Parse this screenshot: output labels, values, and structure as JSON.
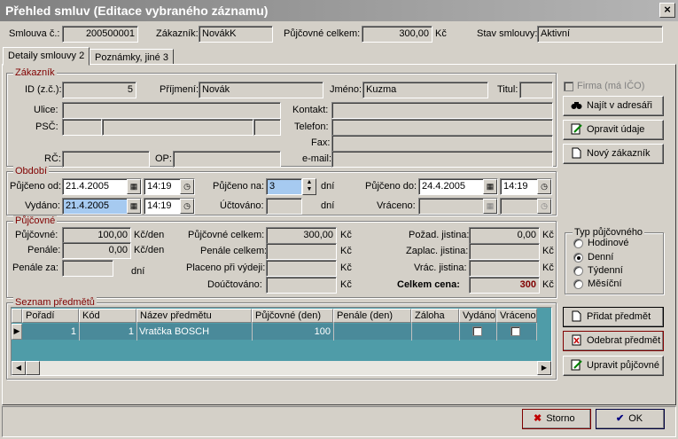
{
  "window": {
    "title": "Přehled smluv (Editace vybraného záznamu)"
  },
  "header": {
    "contract_label": "Smlouva č.:",
    "contract_value": "200500001",
    "customer_label": "Zákazník:",
    "customer_value": "NovákK",
    "rental_total_label": "Půjčovné celkem:",
    "rental_total_value": "300,00",
    "rental_total_currency": "Kč",
    "state_label": "Stav smlouvy:",
    "state_value": "Aktivní"
  },
  "tabs": [
    {
      "label": "Detaily smlouvy 2"
    },
    {
      "label": "Poznámky, jiné 3"
    }
  ],
  "customer": {
    "title": "Zákazník",
    "id_label": "ID (z.č.):",
    "id_value": "5",
    "surname_label": "Příjmení:",
    "surname_value": "Novák",
    "name_label": "Jméno:",
    "name_value": "Kuzma",
    "titul_label": "Titul:",
    "titul_value": "",
    "firm_label": "Firma (má IČO)",
    "street_label": "Ulice:",
    "psc_label": "PSČ:",
    "contact_label": "Kontakt:",
    "phone_label": "Telefon:",
    "fax_label": "Fax:",
    "email_label": "e-mail:",
    "rc_label": "RČ:",
    "op_label": "OP:",
    "btn_find": "Najít v adresáři",
    "btn_edit": "Opravit údaje",
    "btn_new": "Nový zákazník"
  },
  "period": {
    "title": "Období",
    "lent_from_label": "Půjčeno od:",
    "lent_from_date": "21.4.2005",
    "lent_from_time": "14:19",
    "issued_label": "Vydáno:",
    "issued_date": "21.4.2005",
    "issued_time": "14:19",
    "lent_for_label": "Půjčeno na:",
    "lent_for_value": "3",
    "lent_for_unit": "dní",
    "billed_label": "Účtováno:",
    "billed_value": "",
    "billed_unit": "dní",
    "lent_to_label": "Půjčeno do:",
    "lent_to_date": "24.4.2005",
    "lent_to_time": "14:19",
    "returned_label": "Vráceno:"
  },
  "rental": {
    "title": "Půjčovné",
    "rental_label": "Půjčovné:",
    "rental_value": "100,00",
    "rental_unit": "Kč/den",
    "penalty_label": "Penále:",
    "penalty_value": "0,00",
    "penalty_unit": "Kč/den",
    "penalty_for_label": "Penále za:",
    "penalty_for_unit": "dní",
    "rental_total_label": "Půjčovné celkem:",
    "rental_total_value": "300,00",
    "kc": "Kč",
    "penalty_total_label": "Penále celkem:",
    "paid_label": "Placeno při výdeji:",
    "extra_label": "Doúčtováno:",
    "deposit_req_label": "Požad. jistina:",
    "deposit_req_value": "0,00",
    "deposit_paid_label": "Zaplac. jistina:",
    "deposit_ret_label": "Vrác. jistina:",
    "total_label": "Celkem cena:",
    "total_value": "300",
    "type_title": "Typ půjčovného",
    "types": [
      {
        "label": "Hodinové",
        "on": false
      },
      {
        "label": "Denní",
        "on": true
      },
      {
        "label": "Týdenní",
        "on": false
      },
      {
        "label": "Měsíční",
        "on": false
      }
    ]
  },
  "items": {
    "title": "Seznam předmětů",
    "columns": [
      "Pořadí",
      "Kód",
      "Název předmětu",
      "Půjčovné (den)",
      "Penále (den)",
      "Záloha",
      "Vydáno",
      "Vráceno"
    ],
    "rows": [
      {
        "order": "1",
        "code": "1",
        "name": "Vratčka BOSCH",
        "rent": "100",
        "penalty": "",
        "deposit": ""
      }
    ],
    "btn_add": "Přidat předmět",
    "btn_remove": "Odebrat předmět",
    "btn_edit": "Upravit půjčovné"
  },
  "footer": {
    "cancel": "Storno",
    "ok": "OK"
  }
}
